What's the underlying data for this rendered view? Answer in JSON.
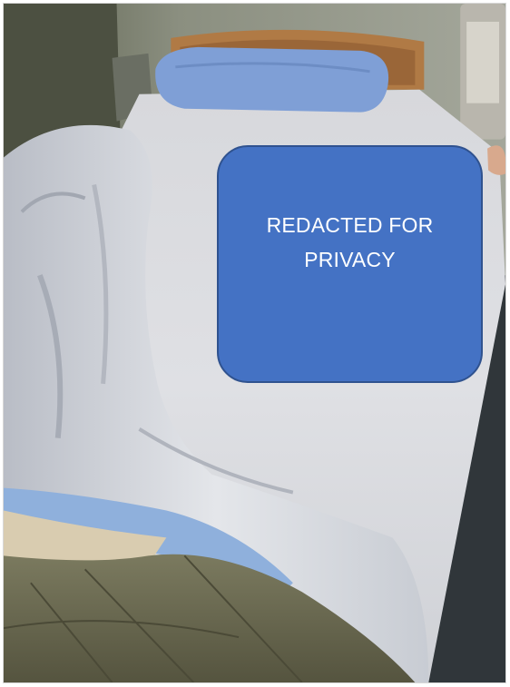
{
  "image": {
    "alt": "Photo of a hospital-style bed with a white sheet, a blue pillow, and a rumpled white blanket with a tan/olive comforter at the foot",
    "colors": {
      "wall": "#8a8f7e",
      "floor": "#2f3437",
      "sheet": "#dfe0e4",
      "pillow": "#7f9fd6",
      "comforter": "#6c6b52",
      "headboard": "#b07a45"
    }
  },
  "redaction": {
    "text": "REDACTED FOR PRIVACY",
    "fill": "#4472c4",
    "border": "#2f528f"
  }
}
